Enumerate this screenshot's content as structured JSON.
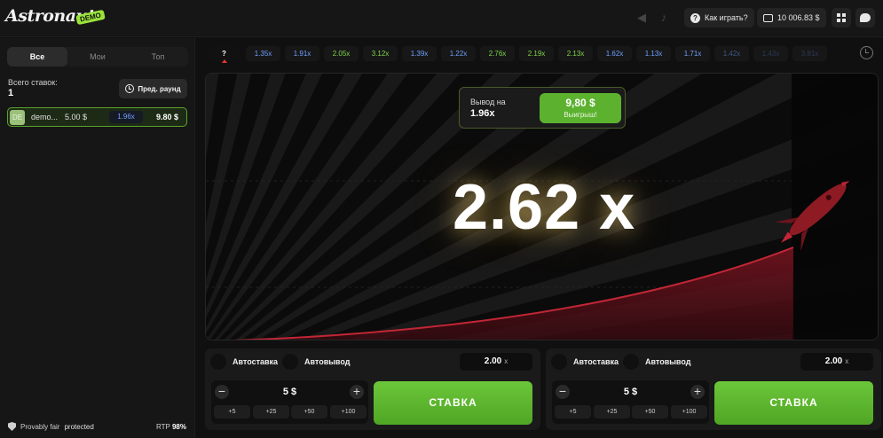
{
  "header": {
    "logo": "Astronaut",
    "demo_badge": "DEMO",
    "how_to_play": "Как играть?",
    "balance": "10 006.83 $"
  },
  "sidebar": {
    "tabs": [
      {
        "label": "Все",
        "active": true
      },
      {
        "label": "Мои",
        "active": false
      },
      {
        "label": "Топ",
        "active": false
      }
    ],
    "total_bets_label": "Всего ставок:",
    "total_bets_count": "1",
    "prev_round_label": "Пред. раунд",
    "bets": [
      {
        "avatar": "DE",
        "user": "demo...",
        "amount": "5.00 $",
        "multiplier": "1.96x",
        "win": "9.80 $"
      }
    ],
    "footer": {
      "provably_fair": "Provably fair",
      "protected": "protected",
      "rtp_label": "RTP",
      "rtp_value": "98%"
    }
  },
  "history": [
    {
      "value": "?",
      "tone": "q"
    },
    {
      "value": "1.35x",
      "tone": "blue"
    },
    {
      "value": "1.91x",
      "tone": "blue"
    },
    {
      "value": "2.05x",
      "tone": "green"
    },
    {
      "value": "3.12x",
      "tone": "green"
    },
    {
      "value": "1.39x",
      "tone": "blue"
    },
    {
      "value": "1.22x",
      "tone": "blue"
    },
    {
      "value": "2.76x",
      "tone": "green"
    },
    {
      "value": "2.19x",
      "tone": "green"
    },
    {
      "value": "2.13x",
      "tone": "green"
    },
    {
      "value": "1.62x",
      "tone": "blue"
    },
    {
      "value": "1.13x",
      "tone": "blue"
    },
    {
      "value": "1.71x",
      "tone": "blue"
    },
    {
      "value": "1.42x",
      "tone": "dim"
    },
    {
      "value": "1.43x",
      "tone": "dimmer"
    },
    {
      "value": "3.81x",
      "tone": "dimmer"
    }
  ],
  "game": {
    "cashout_label": "Вывод на",
    "cashout_multiplier": "1.96x",
    "cashout_amount": "9,80 $",
    "cashout_win_label": "Выигрыш!",
    "current_multiplier": "2.62 x",
    "colors": {
      "accent": "#5cb22f",
      "curve": "#b01e2e",
      "rocket": "#8e1b24"
    }
  },
  "panels": [
    {
      "autobet_label": "Автоставка",
      "autocashout_label": "Автовывод",
      "autocashout_value": "2.00",
      "autocashout_unit": "x",
      "stake_value": "5 $",
      "minus": "−",
      "plus": "+",
      "quick": [
        "+5",
        "+25",
        "+50",
        "+100"
      ],
      "stake_button": "СТАВКА"
    },
    {
      "autobet_label": "Автоставка",
      "autocashout_label": "Автовывод",
      "autocashout_value": "2.00",
      "autocashout_unit": "x",
      "stake_value": "5 $",
      "minus": "−",
      "plus": "+",
      "quick": [
        "+5",
        "+25",
        "+50",
        "+100"
      ],
      "stake_button": "СТАВКА"
    }
  ]
}
